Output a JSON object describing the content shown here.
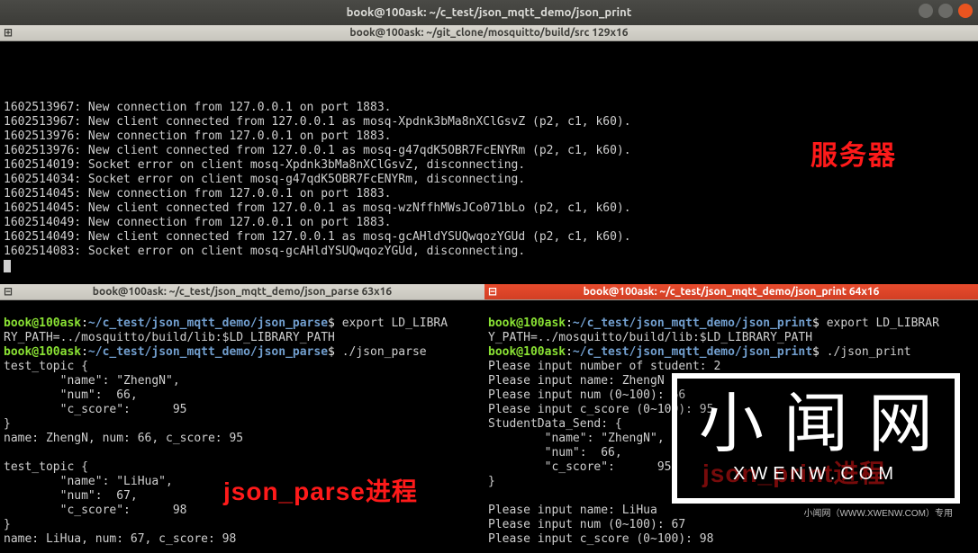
{
  "window": {
    "title": "book@100ask: ~/c_test/json_mqtt_demo/json_print"
  },
  "top_pane": {
    "title": "book@100ask: ~/git_clone/mosquitto/build/src 129x16",
    "lines": [
      "",
      "",
      "",
      "1602513967: New connection from 127.0.0.1 on port 1883.",
      "1602513967: New client connected from 127.0.0.1 as mosq-Xpdnk3bMa8nXClGsvZ (p2, c1, k60).",
      "1602513976: New connection from 127.0.0.1 on port 1883.",
      "1602513976: New client connected from 127.0.0.1 as mosq-g47qdK5OBR7FcENYRm (p2, c1, k60).",
      "1602514019: Socket error on client mosq-Xpdnk3bMa8nXClGsvZ, disconnecting.",
      "1602514034: Socket error on client mosq-g47qdK5OBR7FcENYRm, disconnecting.",
      "1602514045: New connection from 127.0.0.1 on port 1883.",
      "1602514045: New client connected from 127.0.0.1 as mosq-wzNffhMWsJCo071bLo (p2, c1, k60).",
      "1602514049: New connection from 127.0.0.1 on port 1883.",
      "1602514049: New client connected from 127.0.0.1 as mosq-gcAHldYSUQwqozYGUd (p2, c1, k60).",
      "1602514083: Socket error on client mosq-gcAHldYSUQwqozYGUd, disconnecting."
    ]
  },
  "left_pane": {
    "title": "book@100ask: ~/c_test/json_mqtt_demo/json_parse 63x16",
    "prompt_user": "book@100ask",
    "prompt_path": "~/c_test/json_mqtt_demo/json_parse",
    "cmd1_a": "export LD_LIBRA",
    "cmd1_b": "RY_PATH=../mosquitto/build/lib:$LD_LIBRARY_PATH",
    "cmd2": "./json_parse",
    "out": [
      "test_topic {",
      "        \"name\": \"ZhengN\",",
      "        \"num\":  66,",
      "        \"c_score\":      95",
      "}",
      "name: ZhengN, num: 66, c_score: 95",
      "",
      "test_topic {",
      "        \"name\": \"LiHua\",",
      "        \"num\":  67,",
      "        \"c_score\":      98",
      "}",
      "name: LiHua, num: 67, c_score: 98"
    ]
  },
  "right_pane": {
    "title": "book@100ask: ~/c_test/json_mqtt_demo/json_print 64x16",
    "prompt_user": "book@100ask",
    "prompt_path": "~/c_test/json_mqtt_demo/json_print",
    "cmd1_a": "export LD_LIBRAR",
    "cmd1_b": "Y_PATH=../mosquitto/build/lib:$LD_LIBRARY_PATH",
    "cmd2": "./json_print",
    "out": [
      "Please input number of student: 2",
      "Please input name: ZhengN",
      "Please input num (0~100): 66",
      "Please input c_score (0~100): 95",
      "StudentData_Send: {",
      "        \"name\": \"ZhengN\",",
      "        \"num\":  66,",
      "        \"c_score\":      95",
      "}",
      "",
      "Please input name: LiHua",
      "Please input num (0~100): 67",
      "Please input c_score (0~100): 98"
    ]
  },
  "annots": {
    "server": "服务器",
    "parse": "json_parse进程",
    "print": "json_print进程"
  },
  "watermark": {
    "cn": "小闻网",
    "en": "XWENW.COM",
    "small": "小闻网（WWW.XWENW.COM）专用"
  }
}
